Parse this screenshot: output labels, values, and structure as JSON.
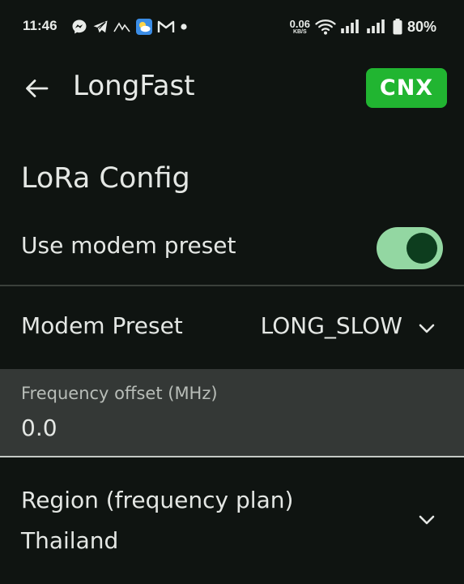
{
  "status_bar": {
    "time": "11:46",
    "net_speed_value": "0.06",
    "net_speed_unit": "KB/S",
    "battery_percent": "80%",
    "icons_left": [
      "messenger-icon",
      "telegram-icon",
      "activity-icon",
      "weather-icon",
      "gmail-icon",
      "notification-dot-icon"
    ],
    "icons_right": [
      "wifi-icon",
      "signal-icon",
      "signal-icon",
      "battery-icon"
    ]
  },
  "app_bar": {
    "title": "LongFast",
    "badge": "CNX",
    "badge_color": "#21b531"
  },
  "section": {
    "title": "LoRa Config"
  },
  "settings": {
    "use_modem_preset": {
      "label": "Use modem preset",
      "enabled": true
    },
    "modem_preset": {
      "label": "Modem Preset",
      "value": "LONG_SLOW"
    },
    "frequency_offset": {
      "label": "Frequency offset (MHz)",
      "value": "0.0"
    },
    "region": {
      "label": "Region (frequency plan)",
      "value": "Thailand"
    }
  },
  "colors": {
    "background": "#0f1411",
    "toggle_track": "#93d7a2",
    "toggle_thumb": "#0d3d1e",
    "field_background": "#343836"
  }
}
